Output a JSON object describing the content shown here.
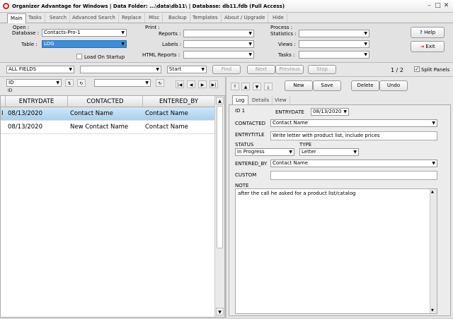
{
  "window": {
    "title": "Organizer Advantage for Windows | Data Folder: ...\\data\\db11\\ | Database: db11.fdb (Full Access)"
  },
  "tabs": [
    "Main",
    "Tasks",
    "Search",
    "Advanced Search",
    "Replace",
    "Misc",
    "Backup",
    "Templates",
    "About / Upgrade",
    "Hide"
  ],
  "open": {
    "section": "Open :",
    "database_label": "Database :",
    "database_value": "Contacts-Pro-1",
    "table_label": "Table :",
    "table_value": "LOG",
    "load_on_startup": "Load On Startup"
  },
  "print": {
    "section": "Print :",
    "reports": "Reports :",
    "labels": "Labels :",
    "html_reports": "HTML Reports :"
  },
  "process": {
    "section": "Process :",
    "statistics": "Statistics :",
    "views": "Views :",
    "tasks": "Tasks :"
  },
  "buttons": {
    "help": "Help",
    "exit": "Exit"
  },
  "search": {
    "field": "ALL FIELDS",
    "mode": "Start",
    "find": "Find",
    "next": "Next",
    "previous": "Previous",
    "stop": "Stop",
    "page": "1 / 2",
    "split_panels": "Split Panels"
  },
  "sort": {
    "field": "ID",
    "sublabel": "ID"
  },
  "grid": {
    "columns": [
      "ENTRYDATE",
      "CONTACTED",
      "ENTERED_BY"
    ],
    "rows": [
      {
        "entrydate": "08/13/2020",
        "contacted": "Contact Name",
        "entered_by": "Contact Name"
      },
      {
        "entrydate": "08/13/2020",
        "contacted": "New Contact Name",
        "entered_by": "Contact Name"
      }
    ]
  },
  "actions": {
    "new": "New",
    "save": "Save",
    "delete": "Delete",
    "undo": "Undo"
  },
  "record_tabs": [
    "Log",
    "Details",
    "View"
  ],
  "record": {
    "id_label": "ID 1",
    "entrydate_label": "ENTRYDATE",
    "entrydate_value": "08/13/2020",
    "contacted_label": "CONTACTED",
    "contacted_value": "Contact Name",
    "entrytitle_label": "ENTRYTITLE",
    "entrytitle_value": "Write letter with product list, include prices",
    "status_label": "STATUS",
    "status_value": "In Progress",
    "type_label": "TYPE",
    "type_value": "Letter",
    "entered_by_label": "ENTERED_BY",
    "entered_by_value": "Contact Name",
    "custom_label": "CUSTOM",
    "custom_value": "",
    "note_label": "NOTE",
    "note_value": "after the call he asked for a product list/catalog"
  }
}
